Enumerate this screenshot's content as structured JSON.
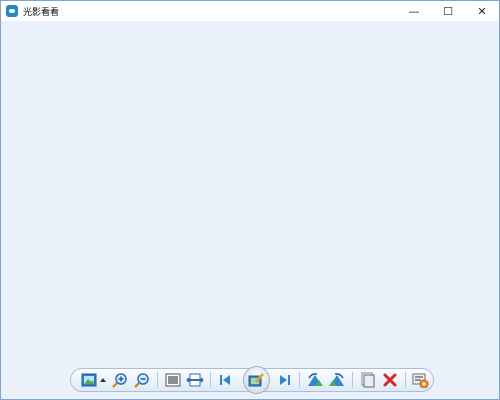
{
  "window": {
    "title": "光影看看",
    "controls": {
      "minimize": "—",
      "maximize": "☐",
      "close": "✕"
    }
  },
  "toolbar": {
    "tools": [
      {
        "name": "image-menu",
        "icon": "picture-icon"
      },
      {
        "name": "zoom-in",
        "icon": "magnifier-plus-icon"
      },
      {
        "name": "zoom-out",
        "icon": "magnifier-minus-icon"
      },
      {
        "name": "fit-window",
        "icon": "fit-window-icon"
      },
      {
        "name": "actual-size",
        "icon": "actual-size-icon"
      },
      {
        "name": "previous",
        "icon": "previous-icon"
      },
      {
        "name": "edit",
        "icon": "edit-image-icon"
      },
      {
        "name": "next",
        "icon": "next-icon"
      },
      {
        "name": "rotate-left",
        "icon": "rotate-left-icon"
      },
      {
        "name": "rotate-right",
        "icon": "rotate-right-icon"
      },
      {
        "name": "copy",
        "icon": "copy-icon"
      },
      {
        "name": "delete",
        "icon": "delete-icon"
      },
      {
        "name": "more",
        "icon": "tools-icon"
      }
    ]
  },
  "colors": {
    "background": "#eaf1fb",
    "window_border": "#7aa7d8",
    "accent_blue": "#1e88c9",
    "delete_red": "#d8262b"
  }
}
